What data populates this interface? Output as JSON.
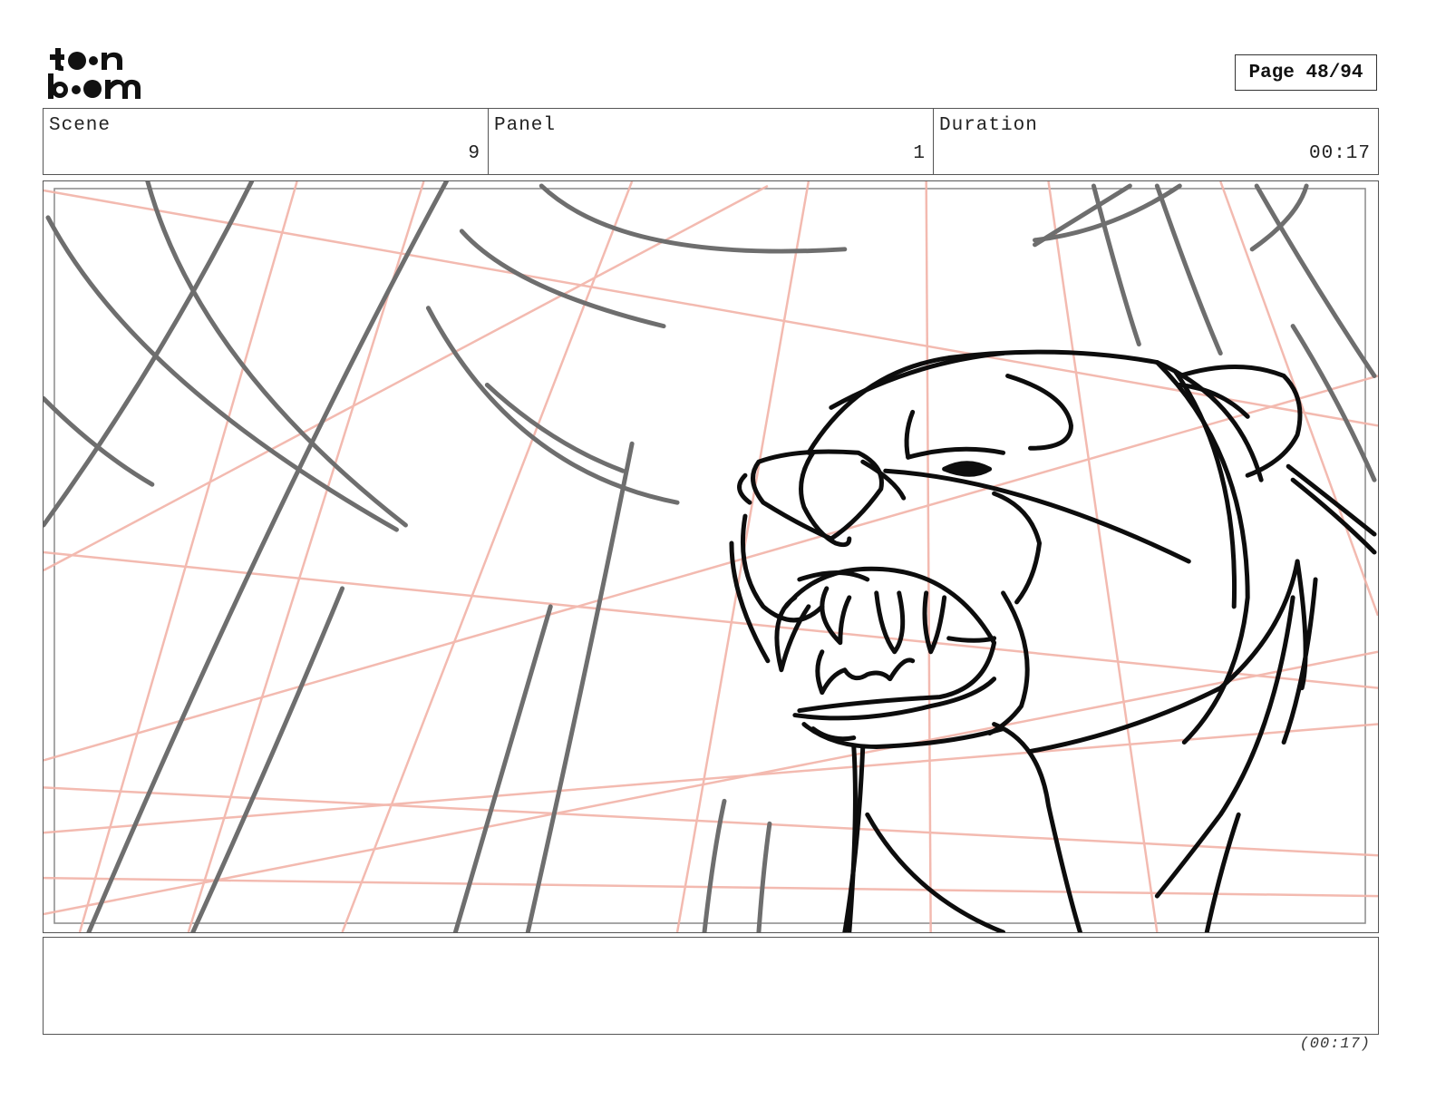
{
  "logo": {
    "line1": "toon",
    "line2": "boom"
  },
  "page": {
    "label": "Page 48/94"
  },
  "header": {
    "scene_label": "Scene",
    "scene_value": "9",
    "panel_label": "Panel",
    "panel_value": "1",
    "duration_label": "Duration",
    "duration_value": "00:17"
  },
  "panel_image": {
    "subject": "snarling-panther-sketch"
  },
  "notes": {
    "text": ""
  },
  "footer": {
    "duration": "(00:17)"
  }
}
